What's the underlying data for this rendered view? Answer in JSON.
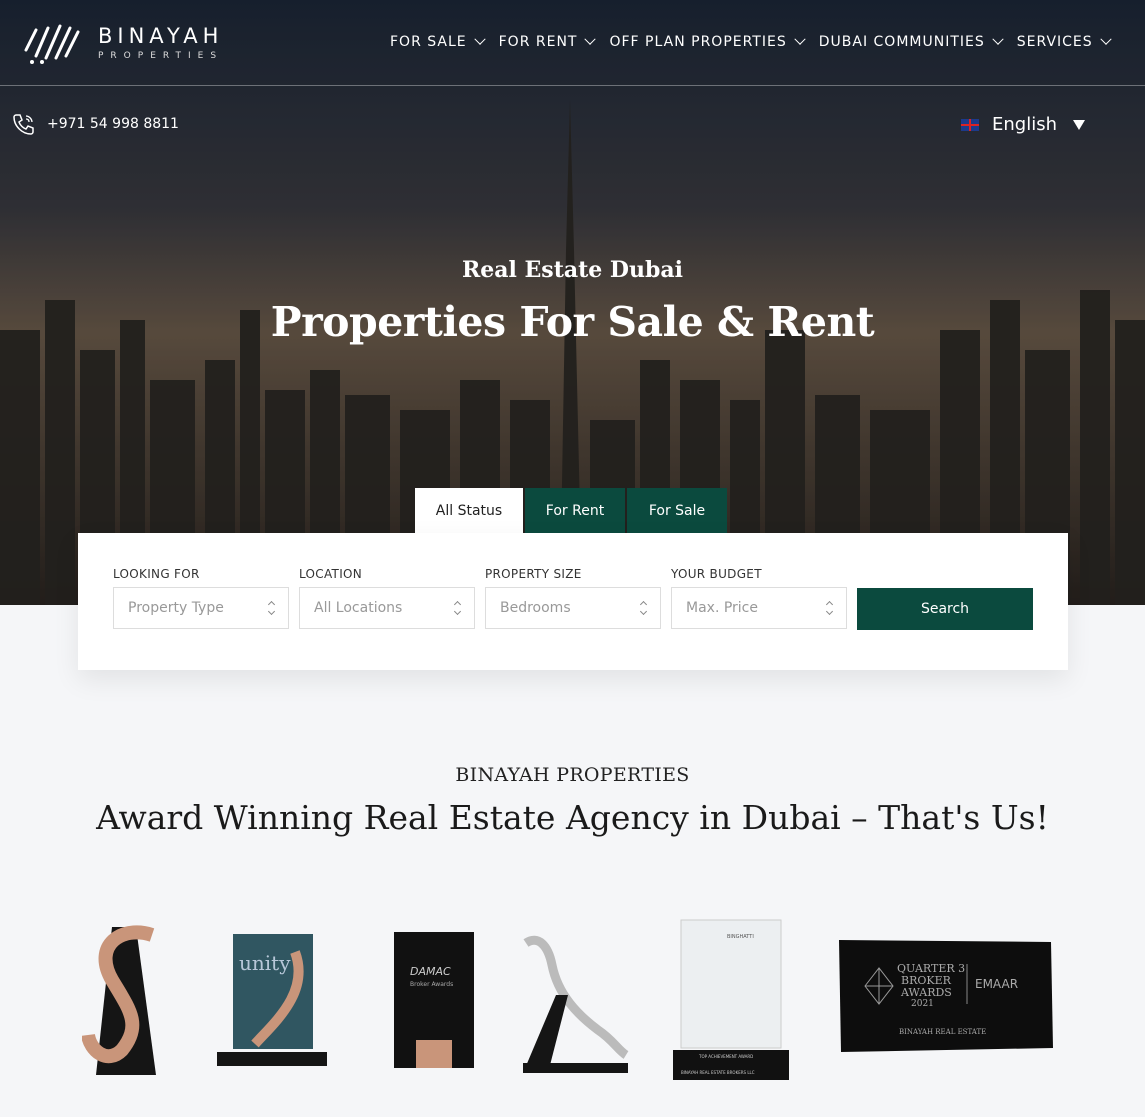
{
  "brand": {
    "name": "BINAYAH",
    "sub": "PROPERTIES"
  },
  "nav": [
    {
      "label": "FOR SALE"
    },
    {
      "label": "FOR RENT"
    },
    {
      "label": "OFF PLAN PROPERTIES"
    },
    {
      "label": "DUBAI COMMUNITIES"
    },
    {
      "label": "SERVICES"
    }
  ],
  "contact": {
    "phone": "+971 54 998 8811"
  },
  "language": {
    "selected": "English"
  },
  "hero": {
    "subtitle": "Real Estate Dubai",
    "title": "Properties For Sale & Rent"
  },
  "search": {
    "tabs": [
      {
        "label": "All Status",
        "active": true
      },
      {
        "label": "For Rent"
      },
      {
        "label": "For Sale"
      }
    ],
    "fields": [
      {
        "label": "LOOKING FOR",
        "value": "Property Type"
      },
      {
        "label": "LOCATION",
        "value": "All Locations"
      },
      {
        "label": "PROPERTY SIZE",
        "value": "Bedrooms"
      },
      {
        "label": "YOUR BUDGET",
        "value": "Max. Price"
      }
    ],
    "button": "Search"
  },
  "about": {
    "kicker": "BINAYAH PROPERTIES",
    "title": "Award Winning Real Estate Agency in Dubai – That's Us!"
  },
  "awards": {
    "damac_unity": "unity",
    "damac": "DAMAC",
    "damac_sub": "Broker Awards",
    "binghatti": "BINGHATTI",
    "top_achievement": "TOP ACHIEVEMENT AWARD",
    "binayah_brokers": "BINAYAH REAL ESTATE BROKERS LLC",
    "emaar_q": "QUARTER 3",
    "emaar_b": "BROKER",
    "emaar_a": "AWARDS",
    "emaar_y": "2021",
    "emaar": "EMAAR",
    "emaar_name": "BINAYAH REAL ESTATE"
  },
  "colors": {
    "accent": "#0b4a3e",
    "background": "#f5f6f8"
  }
}
